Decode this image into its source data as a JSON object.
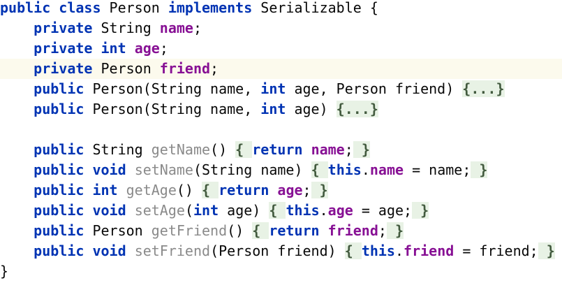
{
  "editor": {
    "current_line_color": "#fcfaed",
    "keyword_color": "#0033b3",
    "field_color": "#871094",
    "method_decl_color": "#8a8a8a",
    "fold_background": "#e8f2e5",
    "lines": [
      {
        "tokens": [
          {
            "t": "kw",
            "v": "public"
          },
          {
            "t": "plain",
            "v": " "
          },
          {
            "t": "kw",
            "v": "class"
          },
          {
            "t": "plain",
            "v": " Person "
          },
          {
            "t": "kw",
            "v": "implements"
          },
          {
            "t": "plain",
            "v": " Serializable {"
          }
        ]
      },
      {
        "tokens": [
          {
            "t": "plain",
            "v": "    "
          },
          {
            "t": "kw",
            "v": "private"
          },
          {
            "t": "plain",
            "v": " String "
          },
          {
            "t": "field",
            "v": "name"
          },
          {
            "t": "plain",
            "v": ";"
          }
        ]
      },
      {
        "tokens": [
          {
            "t": "plain",
            "v": "    "
          },
          {
            "t": "kw",
            "v": "private"
          },
          {
            "t": "plain",
            "v": " "
          },
          {
            "t": "kw",
            "v": "int"
          },
          {
            "t": "plain",
            "v": " "
          },
          {
            "t": "field",
            "v": "age"
          },
          {
            "t": "plain",
            "v": ";"
          }
        ]
      },
      {
        "current": true,
        "tokens": [
          {
            "t": "plain",
            "v": "    "
          },
          {
            "t": "kw",
            "v": "private"
          },
          {
            "t": "plain",
            "v": " Person "
          },
          {
            "t": "field",
            "v": "friend"
          },
          {
            "t": "plain",
            "v": ";"
          }
        ]
      },
      {
        "tokens": [
          {
            "t": "plain",
            "v": "    "
          },
          {
            "t": "kw",
            "v": "public"
          },
          {
            "t": "plain",
            "v": " Person(String name, "
          },
          {
            "t": "kw",
            "v": "int"
          },
          {
            "t": "plain",
            "v": " age, Person friend) "
          },
          {
            "t": "fold",
            "v": "{...}"
          }
        ]
      },
      {
        "tokens": [
          {
            "t": "plain",
            "v": "    "
          },
          {
            "t": "kw",
            "v": "public"
          },
          {
            "t": "plain",
            "v": " Person(String name, "
          },
          {
            "t": "kw",
            "v": "int"
          },
          {
            "t": "plain",
            "v": " age) "
          },
          {
            "t": "fold",
            "v": "{...}"
          }
        ]
      },
      {
        "tokens": []
      },
      {
        "tokens": [
          {
            "t": "plain",
            "v": "    "
          },
          {
            "t": "kw",
            "v": "public"
          },
          {
            "t": "plain",
            "v": " String "
          },
          {
            "t": "method",
            "v": "getName"
          },
          {
            "t": "plain",
            "v": "() "
          },
          {
            "t": "fold",
            "v": "{ "
          },
          {
            "t": "kw",
            "v": "return"
          },
          {
            "t": "plain",
            "v": " "
          },
          {
            "t": "field",
            "v": "name"
          },
          {
            "t": "plain",
            "v": ";"
          },
          {
            "t": "fold",
            "v": " }"
          }
        ]
      },
      {
        "tokens": [
          {
            "t": "plain",
            "v": "    "
          },
          {
            "t": "kw",
            "v": "public"
          },
          {
            "t": "plain",
            "v": " "
          },
          {
            "t": "kw",
            "v": "void"
          },
          {
            "t": "plain",
            "v": " "
          },
          {
            "t": "method",
            "v": "setName"
          },
          {
            "t": "plain",
            "v": "(String name) "
          },
          {
            "t": "fold",
            "v": "{ "
          },
          {
            "t": "kw",
            "v": "this"
          },
          {
            "t": "plain",
            "v": "."
          },
          {
            "t": "field",
            "v": "name"
          },
          {
            "t": "plain",
            "v": " = name;"
          },
          {
            "t": "fold",
            "v": " }"
          }
        ]
      },
      {
        "tokens": [
          {
            "t": "plain",
            "v": "    "
          },
          {
            "t": "kw",
            "v": "public"
          },
          {
            "t": "plain",
            "v": " "
          },
          {
            "t": "kw",
            "v": "int"
          },
          {
            "t": "plain",
            "v": " "
          },
          {
            "t": "method",
            "v": "getAge"
          },
          {
            "t": "plain",
            "v": "() "
          },
          {
            "t": "fold",
            "v": "{ "
          },
          {
            "t": "kw",
            "v": "return"
          },
          {
            "t": "plain",
            "v": " "
          },
          {
            "t": "field",
            "v": "age"
          },
          {
            "t": "plain",
            "v": ";"
          },
          {
            "t": "fold",
            "v": " }"
          }
        ]
      },
      {
        "tokens": [
          {
            "t": "plain",
            "v": "    "
          },
          {
            "t": "kw",
            "v": "public"
          },
          {
            "t": "plain",
            "v": " "
          },
          {
            "t": "kw",
            "v": "void"
          },
          {
            "t": "plain",
            "v": " "
          },
          {
            "t": "method",
            "v": "setAge"
          },
          {
            "t": "plain",
            "v": "("
          },
          {
            "t": "kw",
            "v": "int"
          },
          {
            "t": "plain",
            "v": " age) "
          },
          {
            "t": "fold",
            "v": "{ "
          },
          {
            "t": "kw",
            "v": "this"
          },
          {
            "t": "plain",
            "v": "."
          },
          {
            "t": "field",
            "v": "age"
          },
          {
            "t": "plain",
            "v": " = age;"
          },
          {
            "t": "fold",
            "v": " }"
          }
        ]
      },
      {
        "tokens": [
          {
            "t": "plain",
            "v": "    "
          },
          {
            "t": "kw",
            "v": "public"
          },
          {
            "t": "plain",
            "v": " Person "
          },
          {
            "t": "method",
            "v": "getFriend"
          },
          {
            "t": "plain",
            "v": "() "
          },
          {
            "t": "fold",
            "v": "{ "
          },
          {
            "t": "kw",
            "v": "return"
          },
          {
            "t": "plain",
            "v": " "
          },
          {
            "t": "field",
            "v": "friend"
          },
          {
            "t": "plain",
            "v": ";"
          },
          {
            "t": "fold",
            "v": " }"
          }
        ]
      },
      {
        "tokens": [
          {
            "t": "plain",
            "v": "    "
          },
          {
            "t": "kw",
            "v": "public"
          },
          {
            "t": "plain",
            "v": " "
          },
          {
            "t": "kw",
            "v": "void"
          },
          {
            "t": "plain",
            "v": " "
          },
          {
            "t": "method",
            "v": "setFriend"
          },
          {
            "t": "plain",
            "v": "(Person friend) "
          },
          {
            "t": "fold",
            "v": "{ "
          },
          {
            "t": "kw",
            "v": "this"
          },
          {
            "t": "plain",
            "v": "."
          },
          {
            "t": "field",
            "v": "friend"
          },
          {
            "t": "plain",
            "v": " = friend;"
          },
          {
            "t": "fold",
            "v": " }"
          }
        ]
      },
      {
        "tokens": [
          {
            "t": "plain",
            "v": "}"
          }
        ]
      }
    ]
  }
}
